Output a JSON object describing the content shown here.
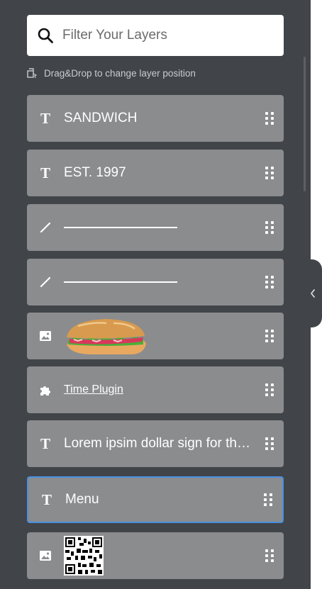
{
  "search": {
    "placeholder": "Filter Your Layers",
    "value": ""
  },
  "hint": {
    "text": "Drag&Drop to change layer position"
  },
  "layers": [
    {
      "type": "text",
      "icon": "T",
      "label": "SANDWICH"
    },
    {
      "type": "text",
      "icon": "T",
      "label": "EST. 1997"
    },
    {
      "type": "line",
      "icon": "line-icon"
    },
    {
      "type": "line",
      "icon": "line-icon"
    },
    {
      "type": "image",
      "icon": "image-icon",
      "preview": "sandwich-image"
    },
    {
      "type": "plugin",
      "icon": "puzzle-icon",
      "label": "Time Plugin"
    },
    {
      "type": "text",
      "icon": "T",
      "label": "Lorem ipsim dollar sign for the..."
    },
    {
      "type": "text",
      "icon": "T",
      "label": "Menu",
      "selected": true
    },
    {
      "type": "image",
      "icon": "image-icon",
      "preview": "qr-code-image"
    }
  ],
  "colors": {
    "panel": "#414449",
    "layer": "#8b8c8e",
    "selected_border": "#4a90e2"
  }
}
